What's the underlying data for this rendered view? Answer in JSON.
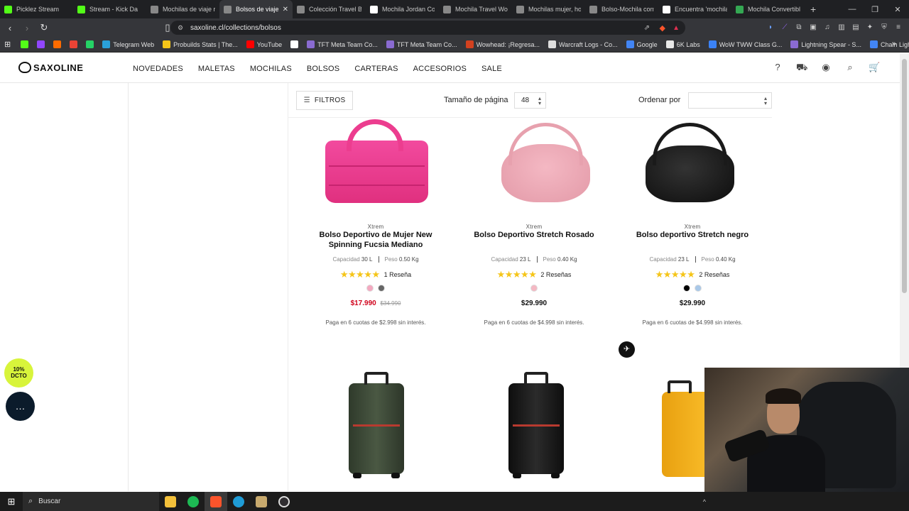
{
  "browser": {
    "tabs": [
      {
        "title": "Picklez Stream",
        "color": "#53fc18"
      },
      {
        "title": "Stream - Kick Da",
        "color": "#53fc18"
      },
      {
        "title": "Mochilas de viaje re",
        "color": "#888888"
      },
      {
        "title": "Bolsos de viaje",
        "color": "#888888",
        "active": true
      },
      {
        "title": "Colección Travel Bla",
        "color": "#888888"
      },
      {
        "title": "Mochila Jordan Col",
        "color": "#ffffff"
      },
      {
        "title": "Mochila Travel Wolf",
        "color": "#888888"
      },
      {
        "title": "Mochilas mujer, hor",
        "color": "#888888"
      },
      {
        "title": "Bolso-Mochila conv",
        "color": "#888888"
      },
      {
        "title": "Encuentra 'mochila",
        "color": "#ffffff"
      },
      {
        "title": "Mochila Convertible",
        "color": "#34a853"
      }
    ],
    "url": "saxoline.cl/collections/bolsos",
    "bookmarks": [
      {
        "label": "",
        "color": "#53fc18"
      },
      {
        "label": "",
        "color": "#9146ff"
      },
      {
        "label": "",
        "color": "#ff6b00"
      },
      {
        "label": "",
        "color": "#ea4335"
      },
      {
        "label": "",
        "color": "#25d366"
      },
      {
        "label": "Telegram Web",
        "color": "#2aa1da"
      },
      {
        "label": "Probuilds Stats | The...",
        "color": "#f5c518"
      },
      {
        "label": "YouTube",
        "color": "#ff0000"
      },
      {
        "label": "",
        "color": "#ffffff"
      },
      {
        "label": "TFT Meta Team Co...",
        "color": "#8a6bd1"
      },
      {
        "label": "TFT Meta Team Co...",
        "color": "#8a6bd1"
      },
      {
        "label": "Wowhead: ¡Regresa...",
        "color": "#d2411f"
      },
      {
        "label": "Warcraft Logs - Co...",
        "color": "#dddddd"
      },
      {
        "label": "Google",
        "color": "#4285f4"
      },
      {
        "label": "6K Labs",
        "color": "#e8e8e8"
      },
      {
        "label": "WoW TWW Class G...",
        "color": "#3b82f6"
      },
      {
        "label": "Lightning Spear - S...",
        "color": "#8a6bd1"
      },
      {
        "label": "Chain Lightning Sor...",
        "color": "#4285f4"
      }
    ]
  },
  "site": {
    "logo": "SAXOLINE",
    "nav": [
      "NOVEDADES",
      "MALETAS",
      "MOCHILAS",
      "BOLSOS",
      "CARTERAS",
      "ACCESORIOS",
      "SALE"
    ]
  },
  "toolbar": {
    "filters": "FILTROS",
    "page_size_label": "Tamaño de página",
    "page_size_value": "48",
    "sort_label": "Ordenar por",
    "sort_value": ""
  },
  "products": [
    {
      "brand": "Xtrem",
      "name": "Bolso Deportivo de Mujer New Spinning Fucsia Mediano",
      "capacity_label": "Capacidad",
      "capacity": "30 L",
      "weight_label": "Peso",
      "weight": "0.50 Kg",
      "stars": "★★★★★",
      "reviews": "1 Reseña",
      "swatches": [
        "#f4a9c0",
        "#666666"
      ],
      "price": "$17.990",
      "old_price": "$34.990",
      "on_sale": true,
      "installments": "Paga en 6 cuotas de $2.998 sin interés."
    },
    {
      "brand": "Xtrem",
      "name": "Bolso Deportivo Stretch Rosado",
      "capacity_label": "Capacidad",
      "capacity": "23 L",
      "weight_label": "Peso",
      "weight": "0.40 Kg",
      "stars": "★★★★★",
      "reviews": "2 Reseñas",
      "swatches": [
        "#f4b8c3"
      ],
      "price": "$29.990",
      "old_price": "",
      "on_sale": false,
      "installments": "Paga en 6 cuotas de $4.998 sin interés."
    },
    {
      "brand": "Xtrem",
      "name": "Bolso deportivo Stretch negro",
      "capacity_label": "Capacidad",
      "capacity": "23 L",
      "weight_label": "Peso",
      "weight": "0.40 Kg",
      "stars": "★★★★★",
      "reviews": "2 Reseñas",
      "swatches": [
        "#000000",
        "#a9c8e8"
      ],
      "price": "$29.990",
      "old_price": "",
      "on_sale": false,
      "installments": "Paga en 6 cuotas de $4.998 sin interés."
    }
  ],
  "widgets": {
    "discount_line1": "10%",
    "discount_line2": "DCTO"
  },
  "taskbar": {
    "search": "Buscar"
  }
}
